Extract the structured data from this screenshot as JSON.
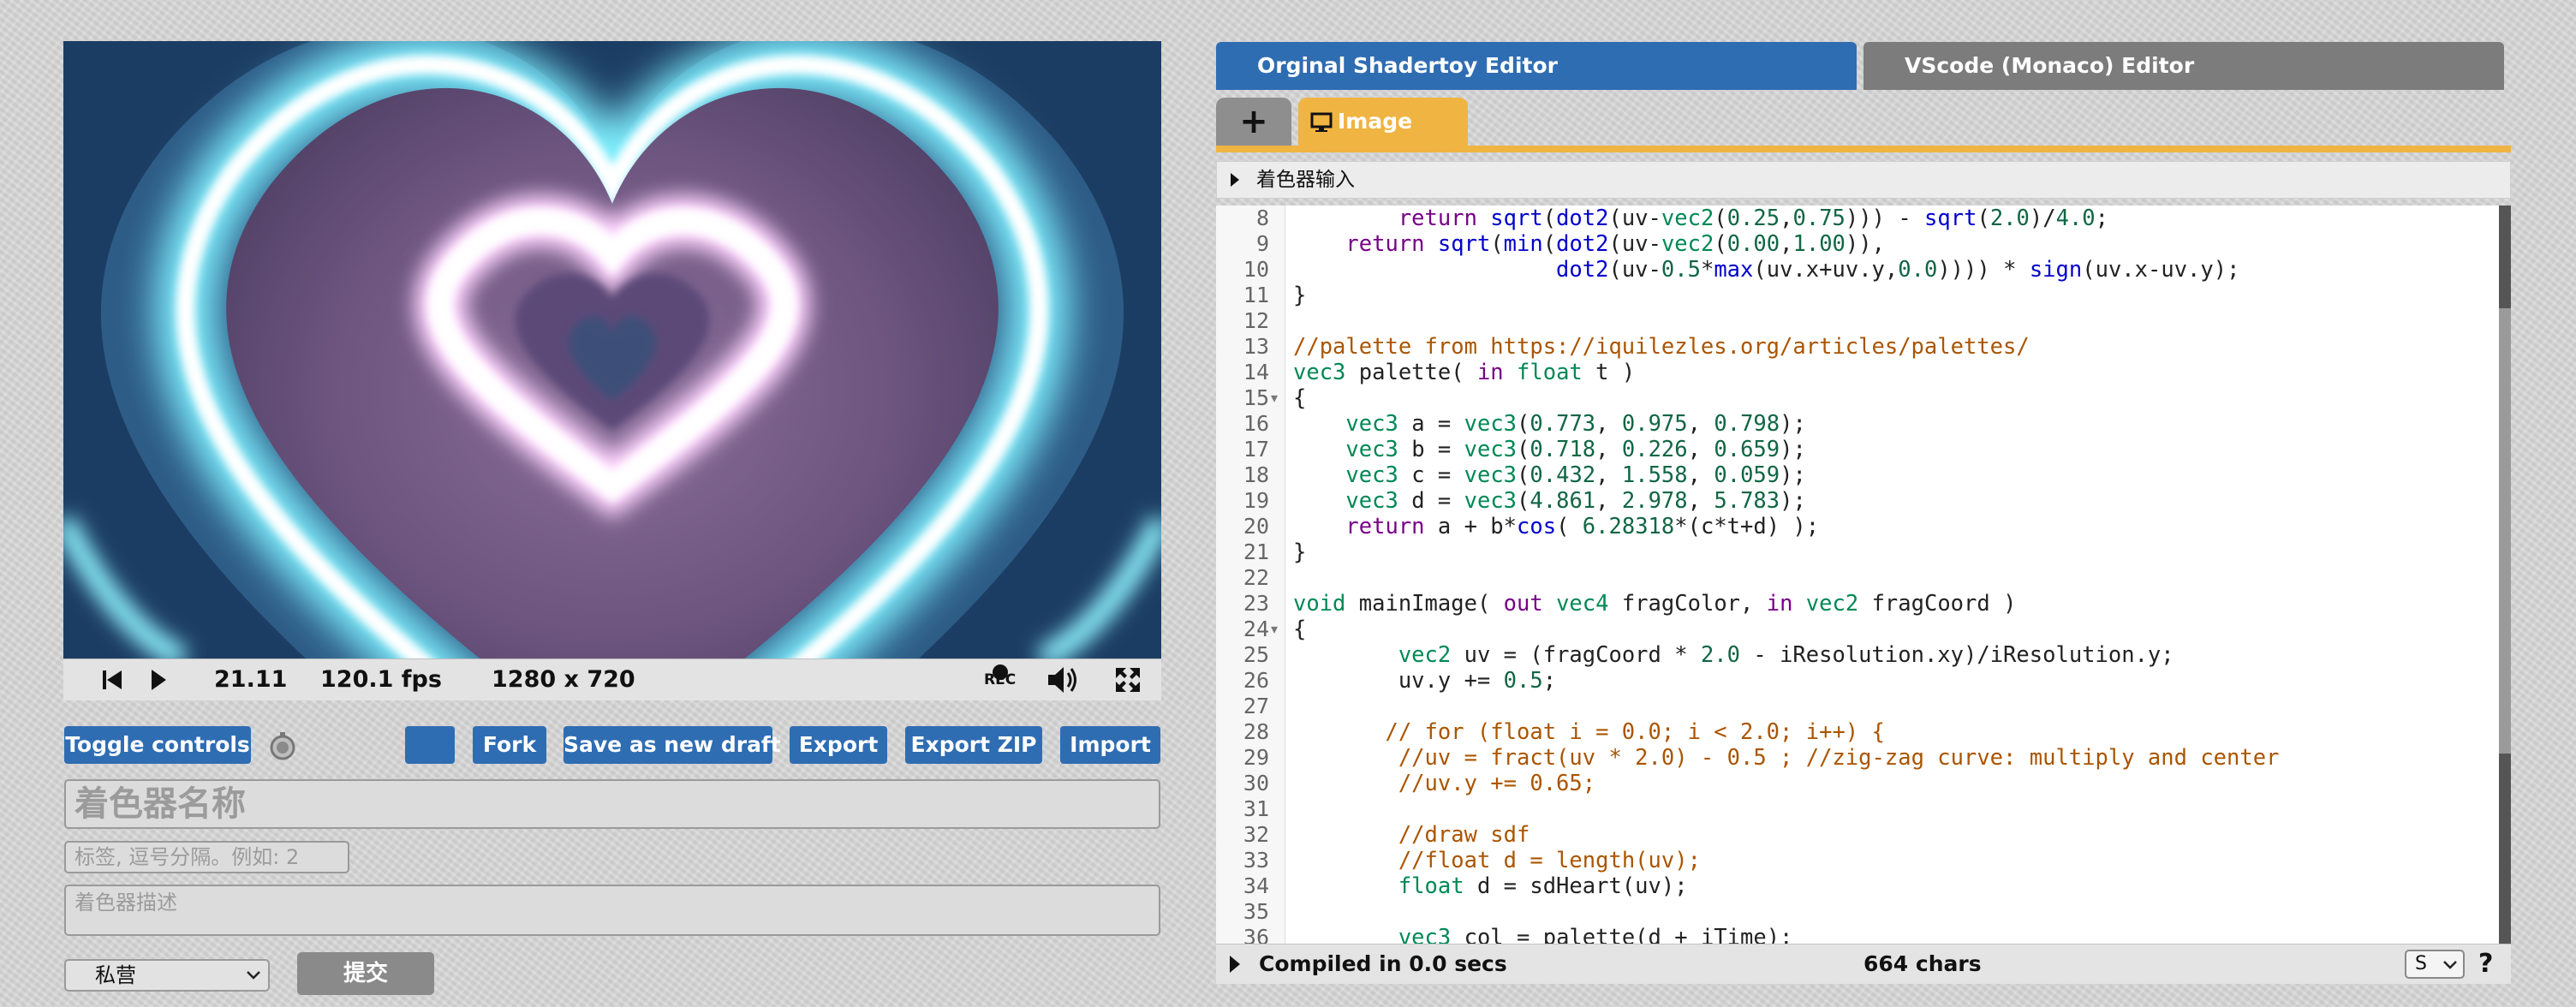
{
  "playback": {
    "time": "21.11",
    "fps": "120.1 fps",
    "resolution": "1280 x 720",
    "rec_label": "REC"
  },
  "controls": {
    "toggle_controls": "Toggle controls",
    "fork": "Fork",
    "save_as_new_draft": "Save as new draft",
    "export": "Export",
    "export_zip": "Export ZIP",
    "import": "Import"
  },
  "form": {
    "name_placeholder": "着色器名称",
    "tags_placeholder": "标签, 逗号分隔。例如: 2",
    "description_placeholder": "着色器描述",
    "visibility_selected": "私营",
    "submit": "提交"
  },
  "editor": {
    "tab_original": "Orginal Shadertoy Editor",
    "tab_vscode": "VScode (Monaco) Editor",
    "add_tab": "+",
    "image_tab": "Image",
    "shader_inputs": "着色器输入",
    "status_compiled": "Compiled in 0.0 secs",
    "status_chars": "664 chars",
    "font_size_select": "S",
    "help": "?"
  },
  "code_lines": [
    {
      "n": "8",
      "tokens": [
        [
          "",
          "        "
        ],
        [
          "k",
          "return "
        ],
        [
          "f",
          "sqrt"
        ],
        [
          "",
          "("
        ],
        [
          "f",
          "dot2"
        ],
        [
          "",
          "(uv-"
        ],
        [
          "t",
          "vec2"
        ],
        [
          "",
          "("
        ],
        [
          "n",
          "0.25"
        ],
        [
          "",
          ","
        ],
        [
          "n",
          "0.75"
        ],
        [
          "",
          ")))"
        ],
        [
          "",
          " - "
        ],
        [
          "f",
          "sqrt"
        ],
        [
          "",
          "("
        ],
        [
          "n",
          "2.0"
        ],
        [
          "",
          ")/"
        ],
        [
          "n",
          "4.0"
        ],
        [
          "",
          ";"
        ]
      ]
    },
    {
      "n": "9",
      "tokens": [
        [
          "",
          "    "
        ],
        [
          "k",
          "return "
        ],
        [
          "f",
          "sqrt"
        ],
        [
          "",
          "("
        ],
        [
          "f",
          "min"
        ],
        [
          "",
          "("
        ],
        [
          "f",
          "dot2"
        ],
        [
          "",
          "(uv-"
        ],
        [
          "t",
          "vec2"
        ],
        [
          "",
          "("
        ],
        [
          "n",
          "0.00"
        ],
        [
          "",
          ","
        ],
        [
          "n",
          "1.00"
        ],
        [
          "",
          ")),"
        ]
      ]
    },
    {
      "n": "10",
      "tokens": [
        [
          "",
          "                    "
        ],
        [
          "f",
          "dot2"
        ],
        [
          "",
          "(uv-"
        ],
        [
          "n",
          "0.5"
        ],
        [
          "",
          "*"
        ],
        [
          "f",
          "max"
        ],
        [
          "",
          "(uv.x+uv.y,"
        ],
        [
          "n",
          "0.0"
        ],
        [
          "",
          "))))"
        ],
        [
          "",
          " * "
        ],
        [
          "f",
          "sign"
        ],
        [
          "",
          "(uv.x-uv.y);"
        ]
      ]
    },
    {
      "n": "11",
      "tokens": [
        [
          "",
          "}"
        ]
      ]
    },
    {
      "n": "12",
      "tokens": []
    },
    {
      "n": "13",
      "tokens": [
        [
          "c",
          "//palette from https://iquilezles.org/articles/palettes/"
        ]
      ]
    },
    {
      "n": "14",
      "tokens": [
        [
          "t",
          "vec3"
        ],
        [
          "",
          " palette( "
        ],
        [
          "k",
          "in "
        ],
        [
          "t",
          "float"
        ],
        [
          "",
          " t )"
        ]
      ]
    },
    {
      "n": "15",
      "fold": true,
      "tokens": [
        [
          "",
          "{"
        ]
      ]
    },
    {
      "n": "16",
      "tokens": [
        [
          "",
          "    "
        ],
        [
          "t",
          "vec3"
        ],
        [
          "",
          " a = "
        ],
        [
          "t",
          "vec3"
        ],
        [
          "",
          "("
        ],
        [
          "n",
          "0.773"
        ],
        [
          "",
          ", "
        ],
        [
          "n",
          "0.975"
        ],
        [
          "",
          ", "
        ],
        [
          "n",
          "0.798"
        ],
        [
          "",
          ");"
        ]
      ]
    },
    {
      "n": "17",
      "tokens": [
        [
          "",
          "    "
        ],
        [
          "t",
          "vec3"
        ],
        [
          "",
          " b = "
        ],
        [
          "t",
          "vec3"
        ],
        [
          "",
          "("
        ],
        [
          "n",
          "0.718"
        ],
        [
          "",
          ", "
        ],
        [
          "n",
          "0.226"
        ],
        [
          "",
          ", "
        ],
        [
          "n",
          "0.659"
        ],
        [
          "",
          ");"
        ]
      ]
    },
    {
      "n": "18",
      "tokens": [
        [
          "",
          "    "
        ],
        [
          "t",
          "vec3"
        ],
        [
          "",
          " c = "
        ],
        [
          "t",
          "vec3"
        ],
        [
          "",
          "("
        ],
        [
          "n",
          "0.432"
        ],
        [
          "",
          ", "
        ],
        [
          "n",
          "1.558"
        ],
        [
          "",
          ", "
        ],
        [
          "n",
          "0.059"
        ],
        [
          "",
          ");"
        ]
      ]
    },
    {
      "n": "19",
      "tokens": [
        [
          "",
          "    "
        ],
        [
          "t",
          "vec3"
        ],
        [
          "",
          " d = "
        ],
        [
          "t",
          "vec3"
        ],
        [
          "",
          "("
        ],
        [
          "n",
          "4.861"
        ],
        [
          "",
          ", "
        ],
        [
          "n",
          "2.978"
        ],
        [
          "",
          ", "
        ],
        [
          "n",
          "5.783"
        ],
        [
          "",
          ");"
        ]
      ]
    },
    {
      "n": "20",
      "tokens": [
        [
          "",
          "    "
        ],
        [
          "k",
          "return "
        ],
        [
          "",
          "a + b*"
        ],
        [
          "f",
          "cos"
        ],
        [
          "",
          "( "
        ],
        [
          "n",
          "6.28318"
        ],
        [
          "",
          "*(c*t+d) );"
        ]
      ]
    },
    {
      "n": "21",
      "tokens": [
        [
          "",
          "}"
        ]
      ]
    },
    {
      "n": "22",
      "tokens": []
    },
    {
      "n": "23",
      "tokens": [
        [
          "t",
          "void"
        ],
        [
          "",
          " mainImage( "
        ],
        [
          "k",
          "out "
        ],
        [
          "t",
          "vec4"
        ],
        [
          "",
          " fragColor, "
        ],
        [
          "k",
          "in "
        ],
        [
          "t",
          "vec2"
        ],
        [
          "",
          " fragCoord )"
        ]
      ]
    },
    {
      "n": "24",
      "fold": true,
      "tokens": [
        [
          "",
          "{"
        ]
      ]
    },
    {
      "n": "25",
      "tokens": [
        [
          "",
          "        "
        ],
        [
          "t",
          "vec2"
        ],
        [
          "",
          " uv = (fragCoord * "
        ],
        [
          "n",
          "2.0"
        ],
        [
          "",
          " - iResolution.xy)/iResolution.y;"
        ]
      ]
    },
    {
      "n": "26",
      "tokens": [
        [
          "",
          "        uv.y += "
        ],
        [
          "n",
          "0.5"
        ],
        [
          "",
          ";"
        ]
      ]
    },
    {
      "n": "27",
      "tokens": []
    },
    {
      "n": "28",
      "tokens": [
        [
          "",
          "       "
        ],
        [
          "c",
          "// for (float i = 0.0; i < 2.0; i++) {"
        ]
      ]
    },
    {
      "n": "29",
      "tokens": [
        [
          "",
          "        "
        ],
        [
          "c",
          "//uv = fract(uv * 2.0) - 0.5 ; //zig-zag curve: multiply and center"
        ]
      ]
    },
    {
      "n": "30",
      "tokens": [
        [
          "",
          "        "
        ],
        [
          "c",
          "//uv.y += 0.65;"
        ]
      ]
    },
    {
      "n": "31",
      "tokens": []
    },
    {
      "n": "32",
      "tokens": [
        [
          "",
          "        "
        ],
        [
          "c",
          "//draw sdf"
        ]
      ]
    },
    {
      "n": "33",
      "tokens": [
        [
          "",
          "        "
        ],
        [
          "c",
          "//float d = length(uv);"
        ]
      ]
    },
    {
      "n": "34",
      "tokens": [
        [
          "",
          "        "
        ],
        [
          "t",
          "float"
        ],
        [
          "",
          " d = sdHeart(uv);"
        ]
      ]
    },
    {
      "n": "35",
      "tokens": []
    },
    {
      "n": "36",
      "tokens": [
        [
          "",
          "        "
        ],
        [
          "t",
          "vec3"
        ],
        [
          "",
          " col = palette(d + iTime);"
        ]
      ]
    }
  ],
  "colors": {
    "accent_blue": "#2f6db3",
    "tab_gray": "#7c7c7c",
    "image_tab_orange": "#f0b442"
  },
  "icons": {
    "rewind": "rewind-icon",
    "play": "play-icon",
    "record": "record-icon",
    "volume": "volume-icon",
    "fullscreen": "fullscreen-icon",
    "stopwatch": "stopwatch-icon",
    "monitor": "monitor-icon"
  }
}
